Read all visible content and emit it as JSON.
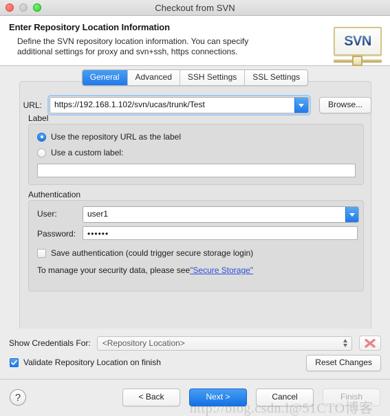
{
  "window": {
    "title": "Checkout from SVN",
    "traffic_lights": [
      "close",
      "minimize",
      "maximize"
    ]
  },
  "header": {
    "title": "Enter Repository Location Information",
    "description_line1": "Define the SVN repository location information. You can specify",
    "description_line2": "additional settings for proxy and svn+ssh, https connections.",
    "logo_text": "SVN"
  },
  "tabs": [
    {
      "label": "General",
      "active": true
    },
    {
      "label": "Advanced",
      "active": false
    },
    {
      "label": "SSH Settings",
      "active": false
    },
    {
      "label": "SSL Settings",
      "active": false
    }
  ],
  "general": {
    "url_label": "URL:",
    "url_value": "https://192.168.1.102/svn/ucas/trunk/Test",
    "browse_label": "Browse...",
    "label_section": {
      "title": "Label",
      "option_repo_url": "Use the repository URL as the label",
      "option_custom": "Use a custom label:",
      "custom_value": "",
      "custom_placeholder": ""
    },
    "authentication": {
      "title": "Authentication",
      "user_label": "User:",
      "user_value": "user1",
      "password_label": "Password:",
      "password_value": "••••••",
      "save_auth_label": "Save authentication (could trigger secure storage login)",
      "save_auth_checked": false,
      "security_note_prefix": "To manage your security data, please see ",
      "security_link": "\"Secure Storage\""
    }
  },
  "footer": {
    "show_credentials_label": "Show Credentials For:",
    "show_credentials_value": "<Repository Location>",
    "delete_icon": "red-x-icon",
    "validate_label": "Validate Repository Location on finish",
    "validate_checked": true,
    "reset_label": "Reset Changes"
  },
  "buttonbar": {
    "help_label": "?",
    "back_label": "< Back",
    "next_label": "Next >",
    "cancel_label": "Cancel",
    "finish_label": "Finish",
    "finish_disabled": true
  },
  "watermark": {
    "text_latin": "http://blog.csdn.l@51CTO",
    "text_cjk": "博客"
  },
  "colors": {
    "accent_blue": "#1f7ae9",
    "tab_active": "#2e8ceb",
    "link_blue": "#2b4fd6",
    "panel_bg": "#e4e4e4",
    "inner_bg": "#dcdcdc",
    "window_bg": "#ececec",
    "delete_red": "#e8868a"
  }
}
